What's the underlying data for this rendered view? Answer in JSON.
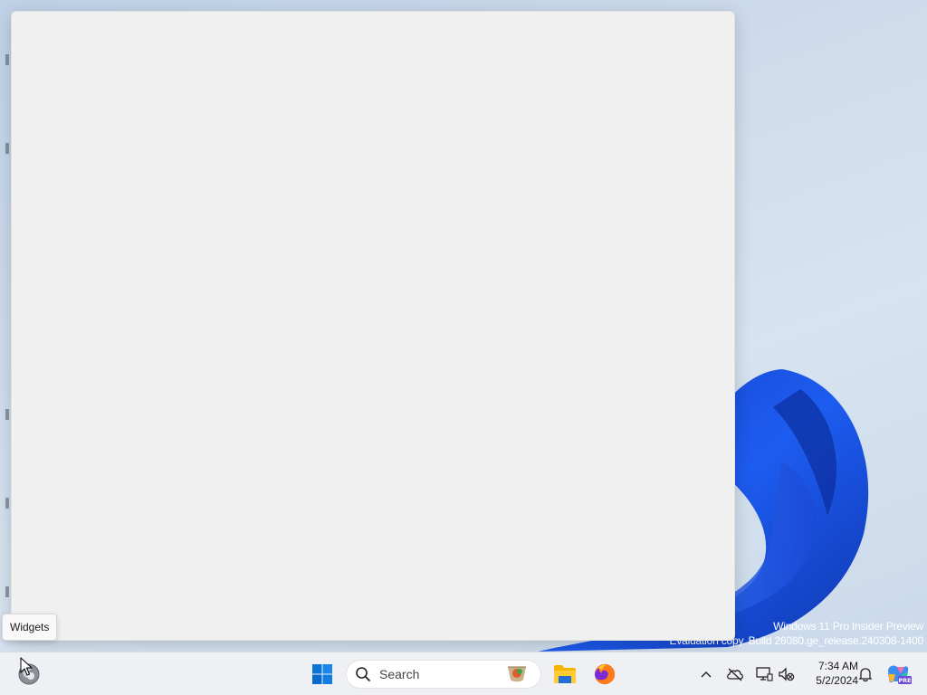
{
  "desktop": {
    "watermark_line1": "Windows 11 Pro Insider Preview",
    "watermark_line2": "Evaluation copy. Build 26080.ge_release.240308-1400"
  },
  "tooltip": {
    "label": "Widgets"
  },
  "taskbar": {
    "search_placeholder": "Search",
    "icons": {
      "widgets": "widgets-icon",
      "start": "windows-logo-icon",
      "search": "search-icon",
      "file_explorer": "folder-icon",
      "firefox": "firefox-icon",
      "chevron": "chevron-up-icon",
      "onedrive": "onedrive-icon",
      "network": "network-icon",
      "volume": "volume-muted-icon",
      "notifications": "bell-icon",
      "copilot": "copilot-icon"
    },
    "clock": {
      "time": "7:34 AM",
      "date": "5/2/2024"
    },
    "copilot_badge": "PRE"
  },
  "colors": {
    "accent": "#0067c0",
    "bloom": "#1a52d8",
    "taskbar": "#eef0f4",
    "panel": "#f0f0f0"
  }
}
